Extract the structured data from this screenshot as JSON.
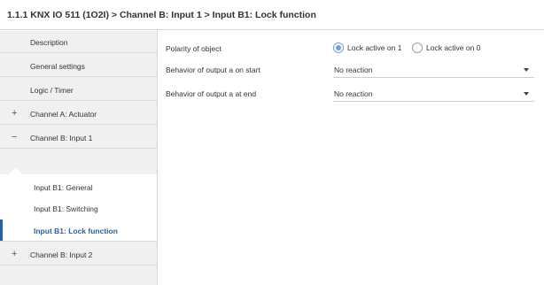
{
  "breadcrumb": "1.1.1 KNX IO 511 (1O2I) > Channel B: Input 1 > Input B1: Lock function",
  "sidebar": {
    "items": [
      {
        "label": "Description"
      },
      {
        "label": "General settings"
      },
      {
        "label": "Logic / Timer"
      },
      {
        "label": "Channel A: Actuator",
        "toggle": "+"
      },
      {
        "label": "Channel B: Input 1",
        "toggle": "−"
      },
      {
        "label": "Input B1: General"
      },
      {
        "label": "Input B1: Switching"
      },
      {
        "label": "Input B1: Lock function"
      },
      {
        "label": "Channel B: Input 2",
        "toggle": "+"
      }
    ]
  },
  "params": {
    "polarity": {
      "label": "Polarity of object",
      "options": [
        "Lock active on 1",
        "Lock active on 0"
      ],
      "selected_index": 0
    },
    "start": {
      "label": "Behavior of output a on start",
      "value": "No reaction"
    },
    "end": {
      "label": "Behavior of output a at end",
      "value": "No reaction"
    }
  },
  "colors": {
    "accent": "#2a5f9e",
    "radio": "#7a9ccf",
    "sidebar_bg": "#f0f0f0"
  }
}
